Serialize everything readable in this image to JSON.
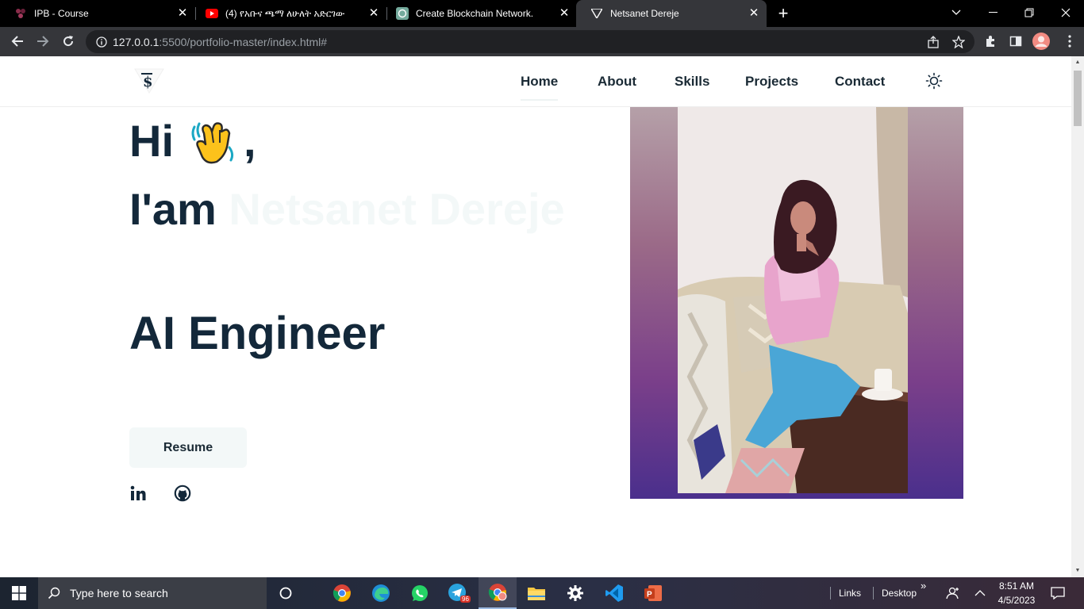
{
  "browser": {
    "tabs": [
      {
        "title": "IPB - Course",
        "favicon": "ipb-icon",
        "active": false
      },
      {
        "title": "(4) የአቡና ጫማ ለሁለት አድርገው ፃፍ",
        "favicon": "youtube-icon",
        "active": false
      },
      {
        "title": "Create Blockchain Network.",
        "favicon": "chatgpt-icon",
        "active": false
      },
      {
        "title": "Netsanet Dereje",
        "favicon": "vercel-icon",
        "active": true
      }
    ],
    "close_glyph": "✕",
    "new_tab_glyph": "+",
    "url_host": "127.0.0.1",
    "url_rest": ":5500/portfolio-master/index.html#"
  },
  "site": {
    "nav": [
      "Home",
      "About",
      "Skills",
      "Projects",
      "Contact"
    ],
    "greeting_prefix": "Hi",
    "greeting_suffix": ",",
    "iam": "I'am",
    "name": "Netsanet Dereje",
    "role": "AI Engineer",
    "resume_label": "Resume",
    "colors": {
      "heading": "#13283a",
      "name_faded": "#f3f8f8",
      "button_bg": "#f3f8f8"
    }
  },
  "taskbar": {
    "search_placeholder": "Type here to search",
    "links_label": "Links",
    "desktop_label": "Desktop",
    "more_glyph": "»",
    "time": "8:51 AM",
    "date": "4/5/2023",
    "telegram_badge": "96"
  }
}
